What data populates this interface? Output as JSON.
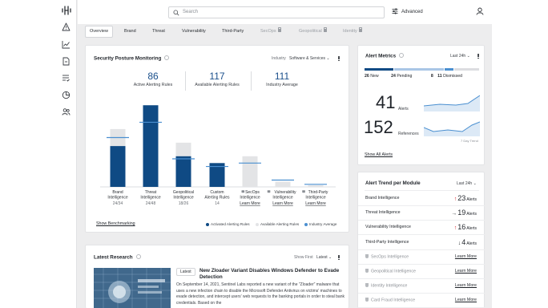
{
  "search": {
    "placeholder": "Search"
  },
  "header": {
    "advanced_label": "Advanced"
  },
  "tabs": [
    {
      "label": "Overview",
      "locked": false,
      "active": true
    },
    {
      "label": "Brand",
      "locked": false
    },
    {
      "label": "Threat",
      "locked": false
    },
    {
      "label": "Vulnerability",
      "locked": false
    },
    {
      "label": "Third-Party",
      "locked": false
    },
    {
      "label": "SecOps",
      "locked": true
    },
    {
      "label": "Geopolitical",
      "locked": true
    },
    {
      "label": "Identity",
      "locked": true
    }
  ],
  "posture": {
    "title": "Security Posture Monitoring",
    "industry_label": "Industry",
    "industry_value": "Software & Services",
    "stats": [
      {
        "value": "86",
        "label": "Active Alerting Rules"
      },
      {
        "value": "117",
        "label": "Available Alerting Rules"
      },
      {
        "value": "111",
        "label": "Industry Average"
      }
    ],
    "link": "Show Benchmarking",
    "legend": [
      "Activated Alerting Rules",
      "Available Alerting Rules",
      "Industry Average"
    ]
  },
  "chart_data": {
    "type": "bar",
    "categories": [
      "Brand Intelligence",
      "Threat Intelligence",
      "Geopolitical Intelligence",
      "Custom Alerting Rules",
      "SecOps Intelligence",
      "Vulnerability Intelligence",
      "Third-Party Intelligence"
    ],
    "category_lines": [
      [
        "Brand",
        "Intelligence"
      ],
      [
        "Threat",
        "Intelligence"
      ],
      [
        "Geopolitical",
        "Intelligence"
      ],
      [
        "Custom",
        "Alerting Rules"
      ],
      [
        "SecOps",
        "Intelligence"
      ],
      [
        "Vulnerability",
        "Intelligence"
      ],
      [
        "Third-Party",
        "Intelligence"
      ]
    ],
    "locked": [
      false,
      false,
      false,
      false,
      true,
      true,
      true
    ],
    "sublabels": [
      "24/34",
      "24/48",
      "18/26",
      "14",
      "Learn More",
      "Learn More",
      "Learn More"
    ],
    "series": [
      {
        "name": "Activated Alerting Rules",
        "values": [
          24,
          48,
          18,
          14,
          0,
          0,
          0
        ],
        "color": "#0f4a84"
      },
      {
        "name": "Available Alerting Rules",
        "values": [
          34,
          48,
          26,
          14,
          18,
          3,
          1
        ],
        "color": "#e3e4e6"
      },
      {
        "name": "Industry Average",
        "values": [
          29,
          38,
          16.5,
          12,
          14,
          4,
          1.5
        ],
        "color": "#4a8fd0"
      }
    ],
    "ylim": [
      0,
      50
    ]
  },
  "alert_metrics": {
    "title": "Alert Metrics",
    "range": "Last 24h",
    "segments": [
      {
        "count": "26",
        "label": "New",
        "color": "#0f4a84",
        "fraction": 0.26
      },
      {
        "count": "24",
        "label": "Pending",
        "color": "#a9c6e6",
        "fraction": 0.44
      },
      {
        "count": "8",
        "label": "",
        "color": "#4a8fd0",
        "fraction": 0.08
      },
      {
        "count": "11",
        "label": "Dismissed",
        "color": "#dcdde0",
        "fraction": 0.22
      }
    ],
    "alerts_value": "41",
    "alerts_label": "Alerts",
    "references_value": "152",
    "references_label": "References",
    "trend_caption": "7 Day Trend",
    "link": "Show All Alerts"
  },
  "alert_trend": {
    "title": "Alert Trend per Module",
    "range": "Last 24h",
    "rows": [
      {
        "name": "Brand Intelligence",
        "value": "23",
        "unit": "Alerts",
        "arrow": "up"
      },
      {
        "name": "Threat Intelligence",
        "value": "19",
        "unit": "Alerts",
        "arrow": "right"
      },
      {
        "name": "Vulnerability Intelligence",
        "value": "16",
        "unit": "Alerts",
        "arrow": "up"
      },
      {
        "name": "Third-Party Intelligence",
        "value": "4",
        "unit": "Alerts",
        "arrow": "down"
      },
      {
        "name": "SecOps Intelligence",
        "locked": true,
        "link": "Learn More"
      },
      {
        "name": "Geopolitical Intelligence",
        "locked": true,
        "link": "Learn More"
      },
      {
        "name": "Identity Intelligence",
        "locked": true,
        "link": "Learn More"
      },
      {
        "name": "Card Fraud Intelligence",
        "locked": true,
        "link": "Learn More"
      }
    ]
  },
  "research": {
    "title": "Latest Research",
    "show_first_label": "Show First",
    "show_first_value": "Latest",
    "badge": "Latest",
    "headline": "New Zloader Variant Disables Windows Defender to Evade Detection",
    "body": "On September 14, 2021, Sentinel Labs reported a new variant of the \"Zloader\" malware that uses a new infection chain to disable the Microsoft Defender Antivirus on victims' machines to evade detection, and intercept users' web requests to the banking portals in order to steal bank credentials. Based on the"
  }
}
